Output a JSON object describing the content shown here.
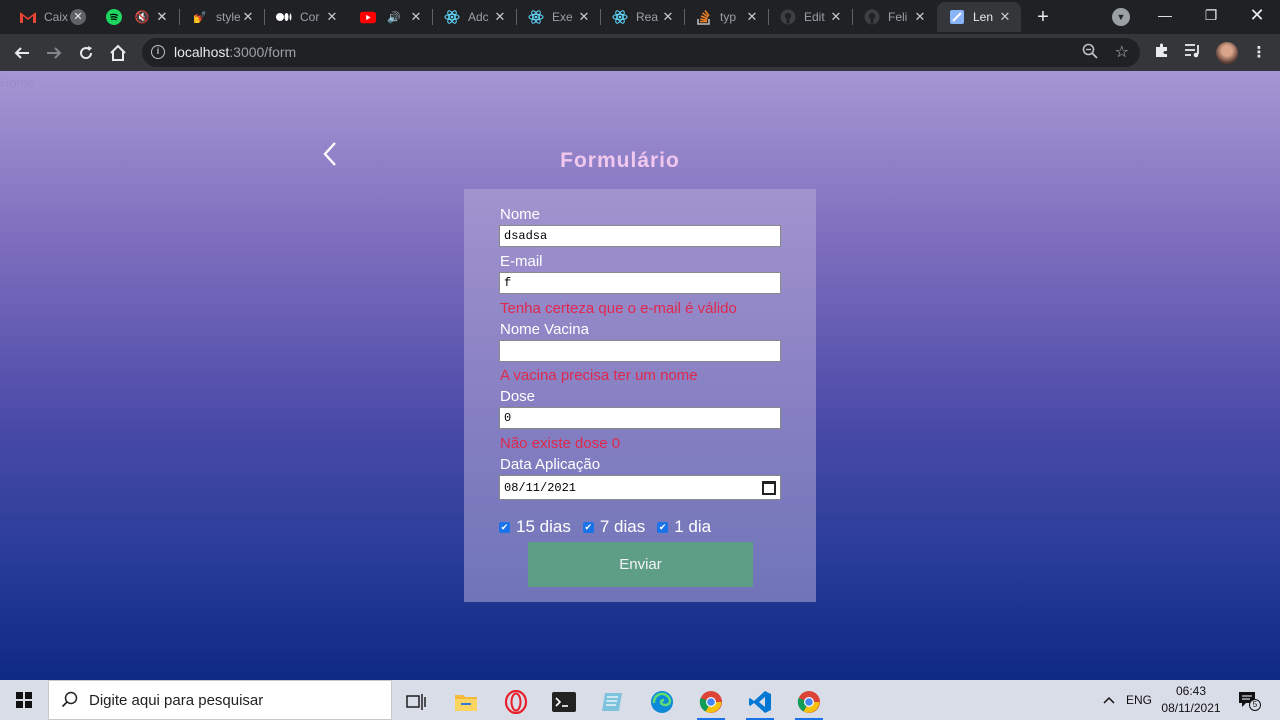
{
  "browser": {
    "tabs": [
      {
        "title": "Caix",
        "favicon": "gmail-icon",
        "active": false
      },
      {
        "title": "",
        "favicon": "spotify-icon",
        "active": false
      },
      {
        "title": "",
        "favicon": "muted-speaker-icon",
        "active": false
      },
      {
        "title": "style",
        "favicon": "styled-components-icon",
        "active": false
      },
      {
        "title": "Cor",
        "favicon": "medium-icon",
        "active": false
      },
      {
        "title": "",
        "favicon": "youtube-icon",
        "active": false
      },
      {
        "title": "Adc",
        "favicon": "react-icon",
        "active": false
      },
      {
        "title": "Exe",
        "favicon": "react-icon",
        "active": false
      },
      {
        "title": "Rea",
        "favicon": "react-icon",
        "active": false
      },
      {
        "title": "typ",
        "favicon": "stackoverflow-icon",
        "active": false
      },
      {
        "title": "Edit",
        "favicon": "github-icon",
        "active": false
      },
      {
        "title": "Feli",
        "favicon": "github-icon",
        "active": false
      },
      {
        "title": "Len",
        "favicon": "page-icon",
        "active": true
      }
    ],
    "url_host": "localhost",
    "url_path": ":3000/form"
  },
  "page": {
    "home_link": "Home",
    "title": "Formulário",
    "fields": {
      "nome_label": "Nome",
      "nome_value": "dsadsa",
      "email_label": "E-mail",
      "email_value": "f",
      "email_error": "Tenha certeza que o e-mail é válido",
      "vacina_label": "Nome Vacina",
      "vacina_value": "",
      "vacina_error": "A vacina precisa ter um nome",
      "dose_label": "Dose",
      "dose_value": "0",
      "dose_error": "Não existe dose 0",
      "data_label": "Data Aplicação",
      "data_value": "08/11/2021"
    },
    "checkboxes": [
      {
        "label": "15 dias",
        "checked": true
      },
      {
        "label": "7 dias",
        "checked": true
      },
      {
        "label": "1 dia",
        "checked": true
      }
    ],
    "submit_label": "Enviar"
  },
  "taskbar": {
    "search_placeholder": "Digite aqui para pesquisar",
    "language": "ENG",
    "time": "06:43",
    "date": "08/11/2021",
    "notifications": "5"
  },
  "colors": {
    "error": "#e0284d",
    "submit_button": "#5e9d86",
    "title": "#f0c8ee"
  }
}
